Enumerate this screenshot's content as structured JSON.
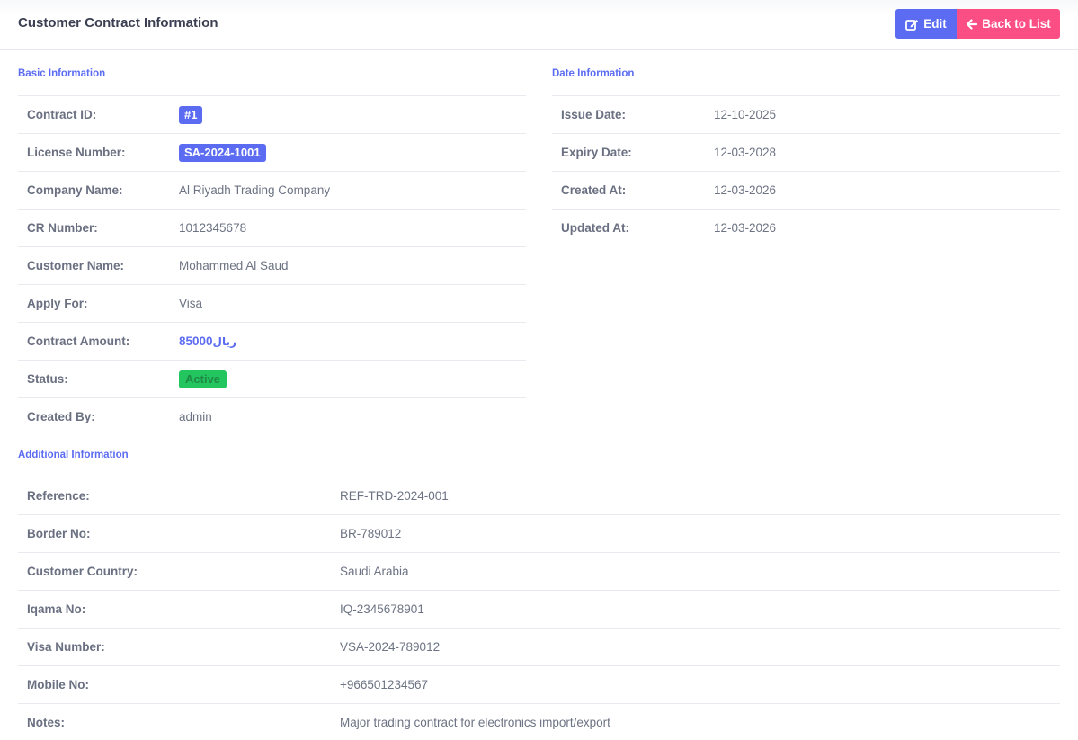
{
  "header": {
    "title": "Customer Contract Information",
    "edit_label": "Edit",
    "back_label": "Back to List",
    "edit_color": "#5c6cf2",
    "back_color": "#fb4e85"
  },
  "basic": {
    "title": "Basic Information",
    "rows": [
      {
        "label": "Contract ID:",
        "value": "#1"
      },
      {
        "label": "License Number:",
        "value": "SA-2024-1001"
      },
      {
        "label": "Company Name:",
        "value": "Al Riyadh Trading Company"
      },
      {
        "label": "CR Number:",
        "value": "1012345678"
      },
      {
        "label": "Customer Name:",
        "value": "Mohammed Al Saud"
      },
      {
        "label": "Apply For:",
        "value": "Visa"
      },
      {
        "label": "Contract Amount:",
        "value": "85000",
        "currency": "ريال"
      },
      {
        "label": "Status:",
        "value": "Active"
      },
      {
        "label": "Created By:",
        "value": "admin"
      }
    ]
  },
  "dates": {
    "title": "Date Information",
    "rows": [
      {
        "label": "Issue Date:",
        "value": "12-10-2025"
      },
      {
        "label": "Expiry Date:",
        "value": "12-03-2028"
      },
      {
        "label": "Created At:",
        "value": "12-03-2026"
      },
      {
        "label": "Updated At:",
        "value": "12-03-2026"
      }
    ]
  },
  "additional": {
    "title": "Additional Information",
    "rows": [
      {
        "label": "Reference:",
        "value": "REF-TRD-2024-001"
      },
      {
        "label": "Border No:",
        "value": "BR-789012"
      },
      {
        "label": "Customer Country:",
        "value": "Saudi Arabia"
      },
      {
        "label": "Iqama No:",
        "value": "IQ-2345678901"
      },
      {
        "label": "Visa Number:",
        "value": "VSA-2024-789012"
      },
      {
        "label": "Mobile No:",
        "value": "+966501234567"
      },
      {
        "label": "Notes:",
        "value": "Major trading contract for electronics import/export"
      }
    ]
  }
}
